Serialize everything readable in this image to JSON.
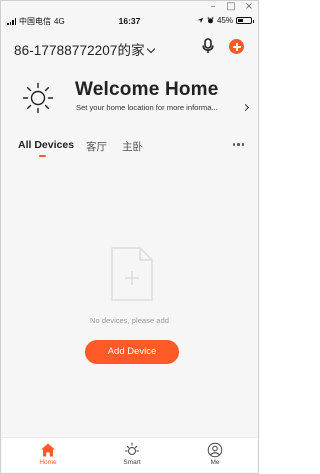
{
  "window": {
    "minimize": "–",
    "maximize": "□",
    "close": "×"
  },
  "status_bar": {
    "carrier": "中国电信",
    "network": "4G",
    "time": "16:37",
    "battery": "45%",
    "battery_level": 0.45
  },
  "header": {
    "home_name": "86-17788772207的家"
  },
  "welcome": {
    "title": "Welcome Home",
    "subtitle": "Set your home location for more informa..."
  },
  "tabs": [
    {
      "label": "All Devices",
      "active": true
    },
    {
      "label": "客厅",
      "active": false
    },
    {
      "label": "主卧",
      "active": false
    }
  ],
  "empty_state": {
    "message": "No devices, please add",
    "button": "Add Device"
  },
  "bottom_nav": [
    {
      "label": "Home",
      "icon": "home-icon",
      "active": true
    },
    {
      "label": "Smart",
      "icon": "smart-sun-icon",
      "active": false
    },
    {
      "label": "Me",
      "icon": "profile-icon",
      "active": false
    }
  ],
  "colors": {
    "accent": "#ff5a28",
    "background": "#f6f6f6"
  }
}
